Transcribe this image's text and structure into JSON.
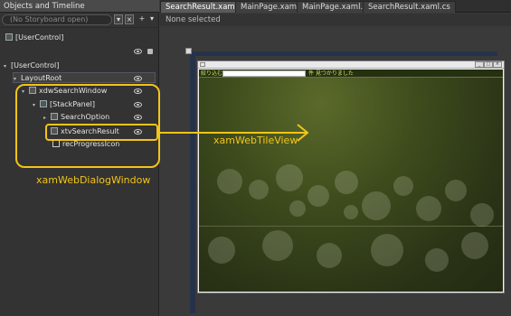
{
  "objects_panel": {
    "title": "Objects and Timeline",
    "storyboard_placeholder": "(No Storyboard open)",
    "storyboard_buttons": [
      "▾",
      "×",
      "+",
      "▾"
    ],
    "user_control_top": "[UserControl]",
    "tree": [
      {
        "label": "[UserControl]",
        "twist": "▾"
      },
      {
        "label": "LayoutRoot",
        "twist": "▾"
      },
      {
        "label": "xdwSearchWindow",
        "twist": "▾"
      },
      {
        "label": "[StackPanel]",
        "twist": "▾"
      },
      {
        "label": "SearchOption",
        "twist": "▸"
      },
      {
        "label": "xtvSearchResult",
        "twist": ""
      },
      {
        "label": "recProgressIcon",
        "twist": ""
      }
    ]
  },
  "tabs": [
    {
      "label": "SearchResult.xaml*",
      "active": true
    },
    {
      "label": "MainPage.xaml*",
      "active": false
    },
    {
      "label": "MainPage.xaml.cs",
      "active": false
    },
    {
      "label": "SearchResult.xaml.cs",
      "active": false
    }
  ],
  "selection_status": "None selected",
  "design_window": {
    "filter_label": "絞り込む",
    "result_label": "件 見つかりました",
    "window_buttons": [
      "_",
      "□",
      "×"
    ]
  },
  "annotations": {
    "dialog_label": "xamWebDialogWindow",
    "tile_label": "xamWebTileView"
  },
  "colors": {
    "annotation": "#f3c419",
    "panel_bg": "#333333"
  }
}
